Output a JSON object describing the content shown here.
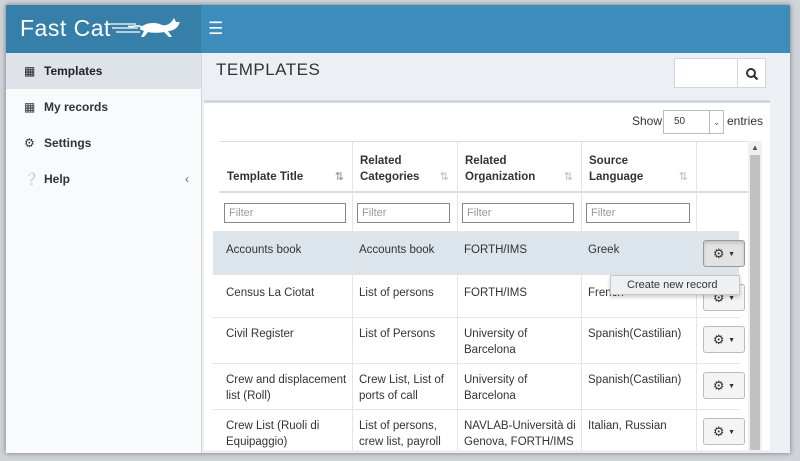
{
  "header": {
    "app_title": "Fast Cat",
    "menu_icon": "hamburger-icon"
  },
  "sidebar": {
    "items": [
      {
        "label": "Templates",
        "icon": "table-icon",
        "active": true
      },
      {
        "label": "My records",
        "icon": "table-icon",
        "active": false
      },
      {
        "label": "Settings",
        "icon": "gear-icon",
        "active": false
      },
      {
        "label": "Help",
        "icon": "question-circle-icon",
        "active": false
      }
    ],
    "help_chevron": "‹"
  },
  "page": {
    "title": "TEMPLATES"
  },
  "search": {
    "value": "",
    "icon": "search-icon"
  },
  "length": {
    "show_label": "Show",
    "value": "50",
    "entries_label": "entries"
  },
  "table": {
    "columns": [
      {
        "label_line1": "",
        "label_line2": "Template Title"
      },
      {
        "label_line1": "Related",
        "label_line2": "Categories"
      },
      {
        "label_line1": "Related",
        "label_line2": "Organization"
      },
      {
        "label_line1": "Source",
        "label_line2": "Language"
      }
    ],
    "filter_placeholder": "Filter",
    "rows": [
      {
        "title": "Accounts book",
        "categories": "Accounts book",
        "organization": "FORTH/IMS",
        "language": "Greek"
      },
      {
        "title": "Census La Ciotat",
        "categories": "List of persons",
        "organization": "FORTH/IMS",
        "language": "French"
      },
      {
        "title": "Civil Register",
        "categories": "List of Persons",
        "organization": "University of Barcelona",
        "language": "Spanish(Castilian)"
      },
      {
        "title": "Crew and displacement list (Roll)",
        "categories": "Crew List, List of ports of call",
        "organization": "University of Barcelona",
        "language": "Spanish(Castilian)"
      },
      {
        "title": "Crew List (Ruoli di Equipaggio)",
        "categories": "List of persons, crew list, payroll",
        "organization": "NAVLAB-Università di Genova, FORTH/IMS",
        "language": "Italian, Russian"
      }
    ]
  },
  "actions": {
    "dropdown_item": "Create new record"
  },
  "colors": {
    "header": "#3c8dbc",
    "logo_bg": "#367fa9",
    "highlight_row": "#dde5ec"
  }
}
